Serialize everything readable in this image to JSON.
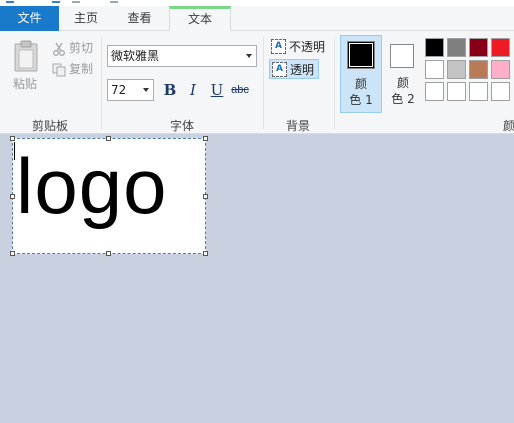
{
  "tabs": {
    "file": "文件",
    "home": "主页",
    "view": "查看",
    "text": "文本"
  },
  "clipboard": {
    "paste": "粘贴",
    "cut": "剪切",
    "copy": "复制",
    "group_label": "剪贴板"
  },
  "font": {
    "family": "微软雅黑",
    "size": "72",
    "bold": "B",
    "italic": "I",
    "underline": "U",
    "strikethrough": "abc",
    "group_label": "字体"
  },
  "background": {
    "opaque": "不透明",
    "transparent": "透明",
    "group_label": "背景"
  },
  "colors": {
    "color1_line1": "颜",
    "color1_line2": "色 1",
    "color2_line1": "颜",
    "color2_line2": "色 2",
    "group_label": "颜",
    "color1_value": "#000000",
    "color2_value": "#ffffff",
    "palette": [
      "#000000",
      "#7f7f7f",
      "#880015",
      "#ed1c24",
      "#ffffff",
      "#c3c3c3",
      "#b97a57",
      "#ffaec9",
      "#ffffff",
      "#ffffff",
      "#ffffff",
      "#ffffff"
    ]
  },
  "canvas": {
    "text": "logo"
  }
}
